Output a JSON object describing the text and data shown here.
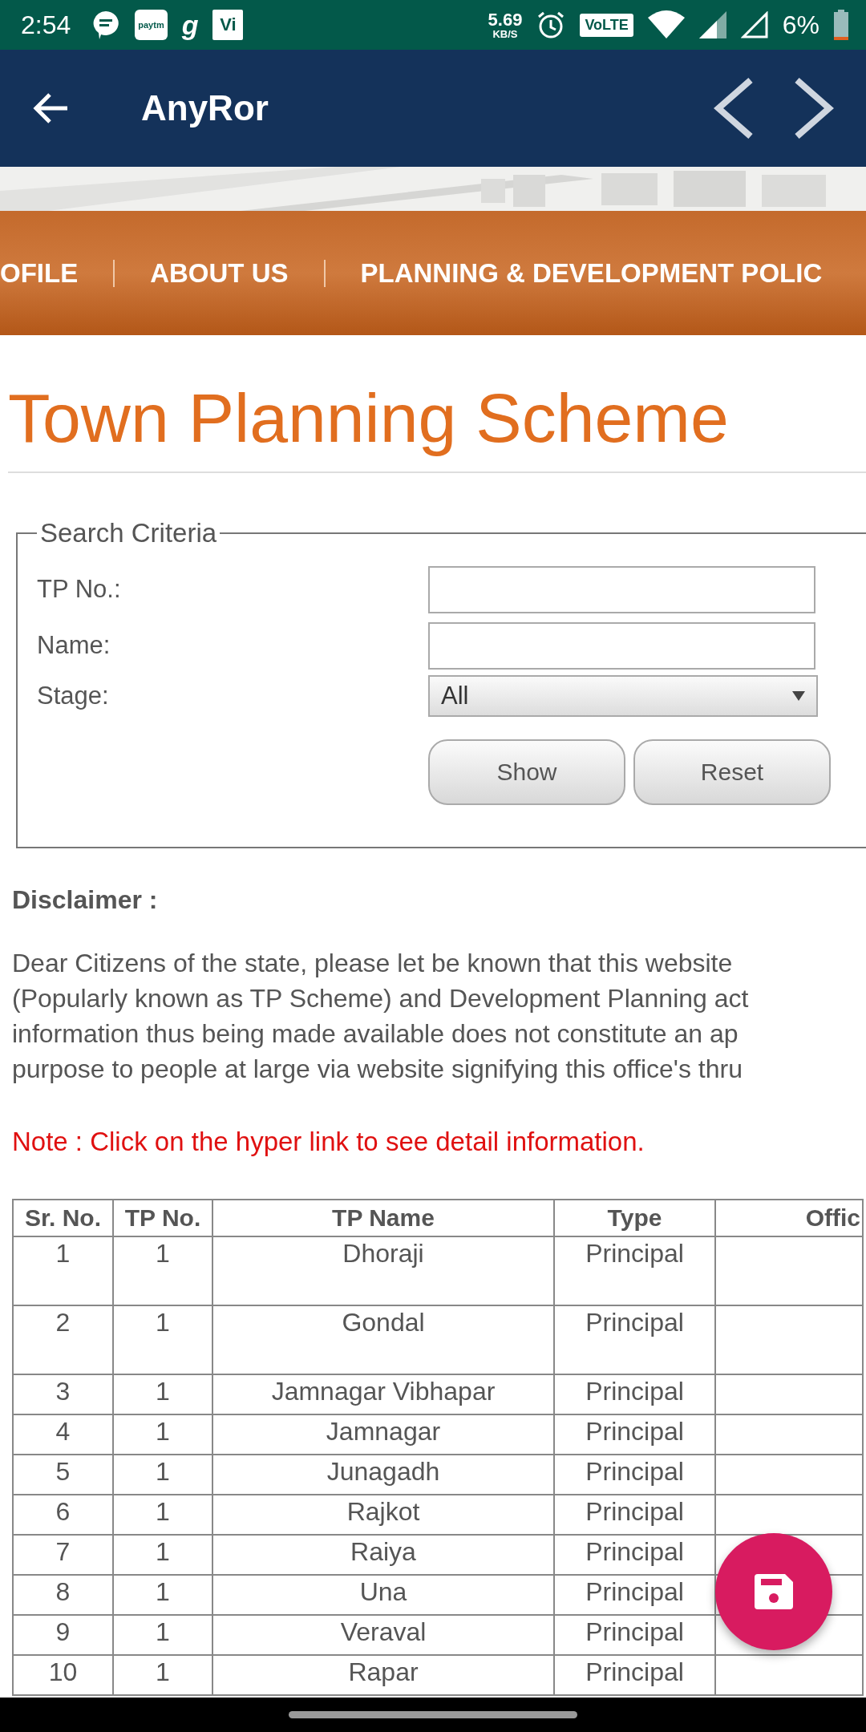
{
  "status_bar": {
    "time": "2:54",
    "notifications": [
      {
        "kind": "chat"
      },
      {
        "kind": "badge",
        "label": "paytm"
      },
      {
        "kind": "letter",
        "label": "g"
      },
      {
        "kind": "badge",
        "label": "Vi"
      }
    ],
    "speed": "5.69",
    "speed_unit": "KB/S",
    "volte": "VoLTE",
    "battery": "6%"
  },
  "app_bar": {
    "title": "AnyRor"
  },
  "nav": {
    "items": [
      "OFILE",
      "ABOUT US",
      "PLANNING & DEVELOPMENT POLIC"
    ]
  },
  "page_title": "Town Planning Scheme",
  "search": {
    "legend": "Search Criteria",
    "fields": [
      {
        "label": "TP No.:",
        "kind": "text"
      },
      {
        "label": "Name:",
        "kind": "text"
      },
      {
        "label": "Stage:",
        "kind": "select",
        "value": "All"
      }
    ],
    "buttons": [
      "Show",
      "Reset"
    ]
  },
  "disclaimer": {
    "heading": "Disclaimer :",
    "lines": [
      "Dear Citizens of the state, please let be known that this website",
      "(Popularly known as TP Scheme) and Development Planning act",
      "information thus being made available does not constitute an ap",
      "purpose to people at large via website signifying this office's thru"
    ],
    "note": "Note : Click on the hyper link to see detail information."
  },
  "table": {
    "columns": [
      "Sr. No.",
      "TP No.",
      "TP Name",
      "Type",
      "Offic"
    ],
    "rows": [
      {
        "cells": [
          "1",
          "1",
          "Dhoraji",
          "Principal"
        ],
        "tall": true
      },
      {
        "cells": [
          "2",
          "1",
          "Gondal",
          "Principal"
        ],
        "tall": true
      },
      {
        "cells": [
          "3",
          "1",
          "Jamnagar Vibhapar",
          "Principal"
        ],
        "tall": false
      },
      {
        "cells": [
          "4",
          "1",
          "Jamnagar",
          "Principal"
        ],
        "tall": false
      },
      {
        "cells": [
          "5",
          "1",
          "Junagadh",
          "Principal"
        ],
        "tall": false
      },
      {
        "cells": [
          "6",
          "1",
          "Rajkot",
          "Principal"
        ],
        "tall": false
      },
      {
        "cells": [
          "7",
          "1",
          "Raiya",
          "Principal"
        ],
        "tall": false
      },
      {
        "cells": [
          "8",
          "1",
          "Una",
          "Principal"
        ],
        "tall": false
      },
      {
        "cells": [
          "9",
          "1",
          "Veraval",
          "Principal"
        ],
        "tall": false
      },
      {
        "cells": [
          "10",
          "1",
          "Rapar",
          "Principal"
        ],
        "tall": false
      }
    ]
  },
  "fab": {
    "kind": "save"
  }
}
